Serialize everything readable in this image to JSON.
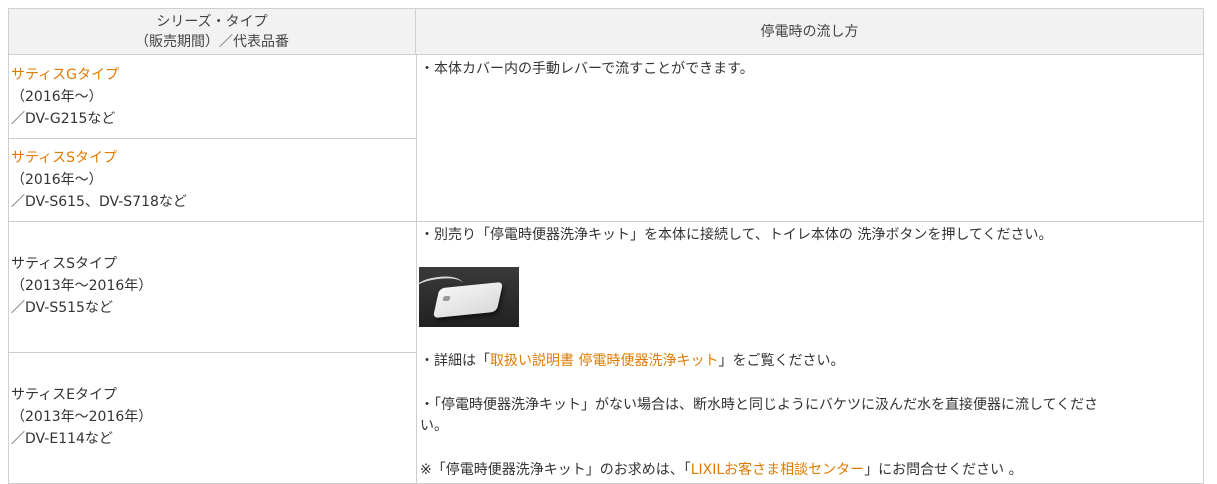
{
  "header": {
    "col1_line1": "シリーズ・タイプ",
    "col1_line2": "（販売期間）／代表品番",
    "col2": "停電時の流し方"
  },
  "rows": [
    {
      "series_link": "サティスGタイプ",
      "period": "（2016年～）",
      "model": "／DV-G215など"
    },
    {
      "series_link": "サティスSタイプ",
      "period": "（2016年～）",
      "model": "／DV-S615、DV-S718など"
    },
    {
      "series": "サティスSタイプ",
      "period": "（2013年～2016年）",
      "model": "／DV-S515など"
    },
    {
      "series": "サティスEタイプ",
      "period": "（2013年～2016年）",
      "model": "／DV-E114など"
    }
  ],
  "method_new": "・本体カバー内の手動レバーで流すことができます。",
  "method_old": {
    "line1": "・別売り「停電時便器洗浄キット」を本体に接続して、トイレ本体の 洗浄ボタンを押してください。",
    "detail_prefix": "・詳細は「",
    "detail_link": "取扱い説明書 停電時便器洗浄キット",
    "detail_suffix": "」をご覧ください。",
    "nokit_line1": "・「停電時便器洗浄キット」がない場合は、断水時と同じようにバケツに汲んだ水を直接便器に流してくださ",
    "nokit_line2": "い。",
    "note_prefix": "※「停電時便器洗浄キット」のお求めは、「",
    "note_link": "LIXILお客さま相談センター",
    "note_suffix": "」にお問合せください 。"
  },
  "colors": {
    "link": "#e07b00",
    "text": "#333333",
    "border": "#cfcfcf",
    "header_bg": "#f2f2f2"
  }
}
